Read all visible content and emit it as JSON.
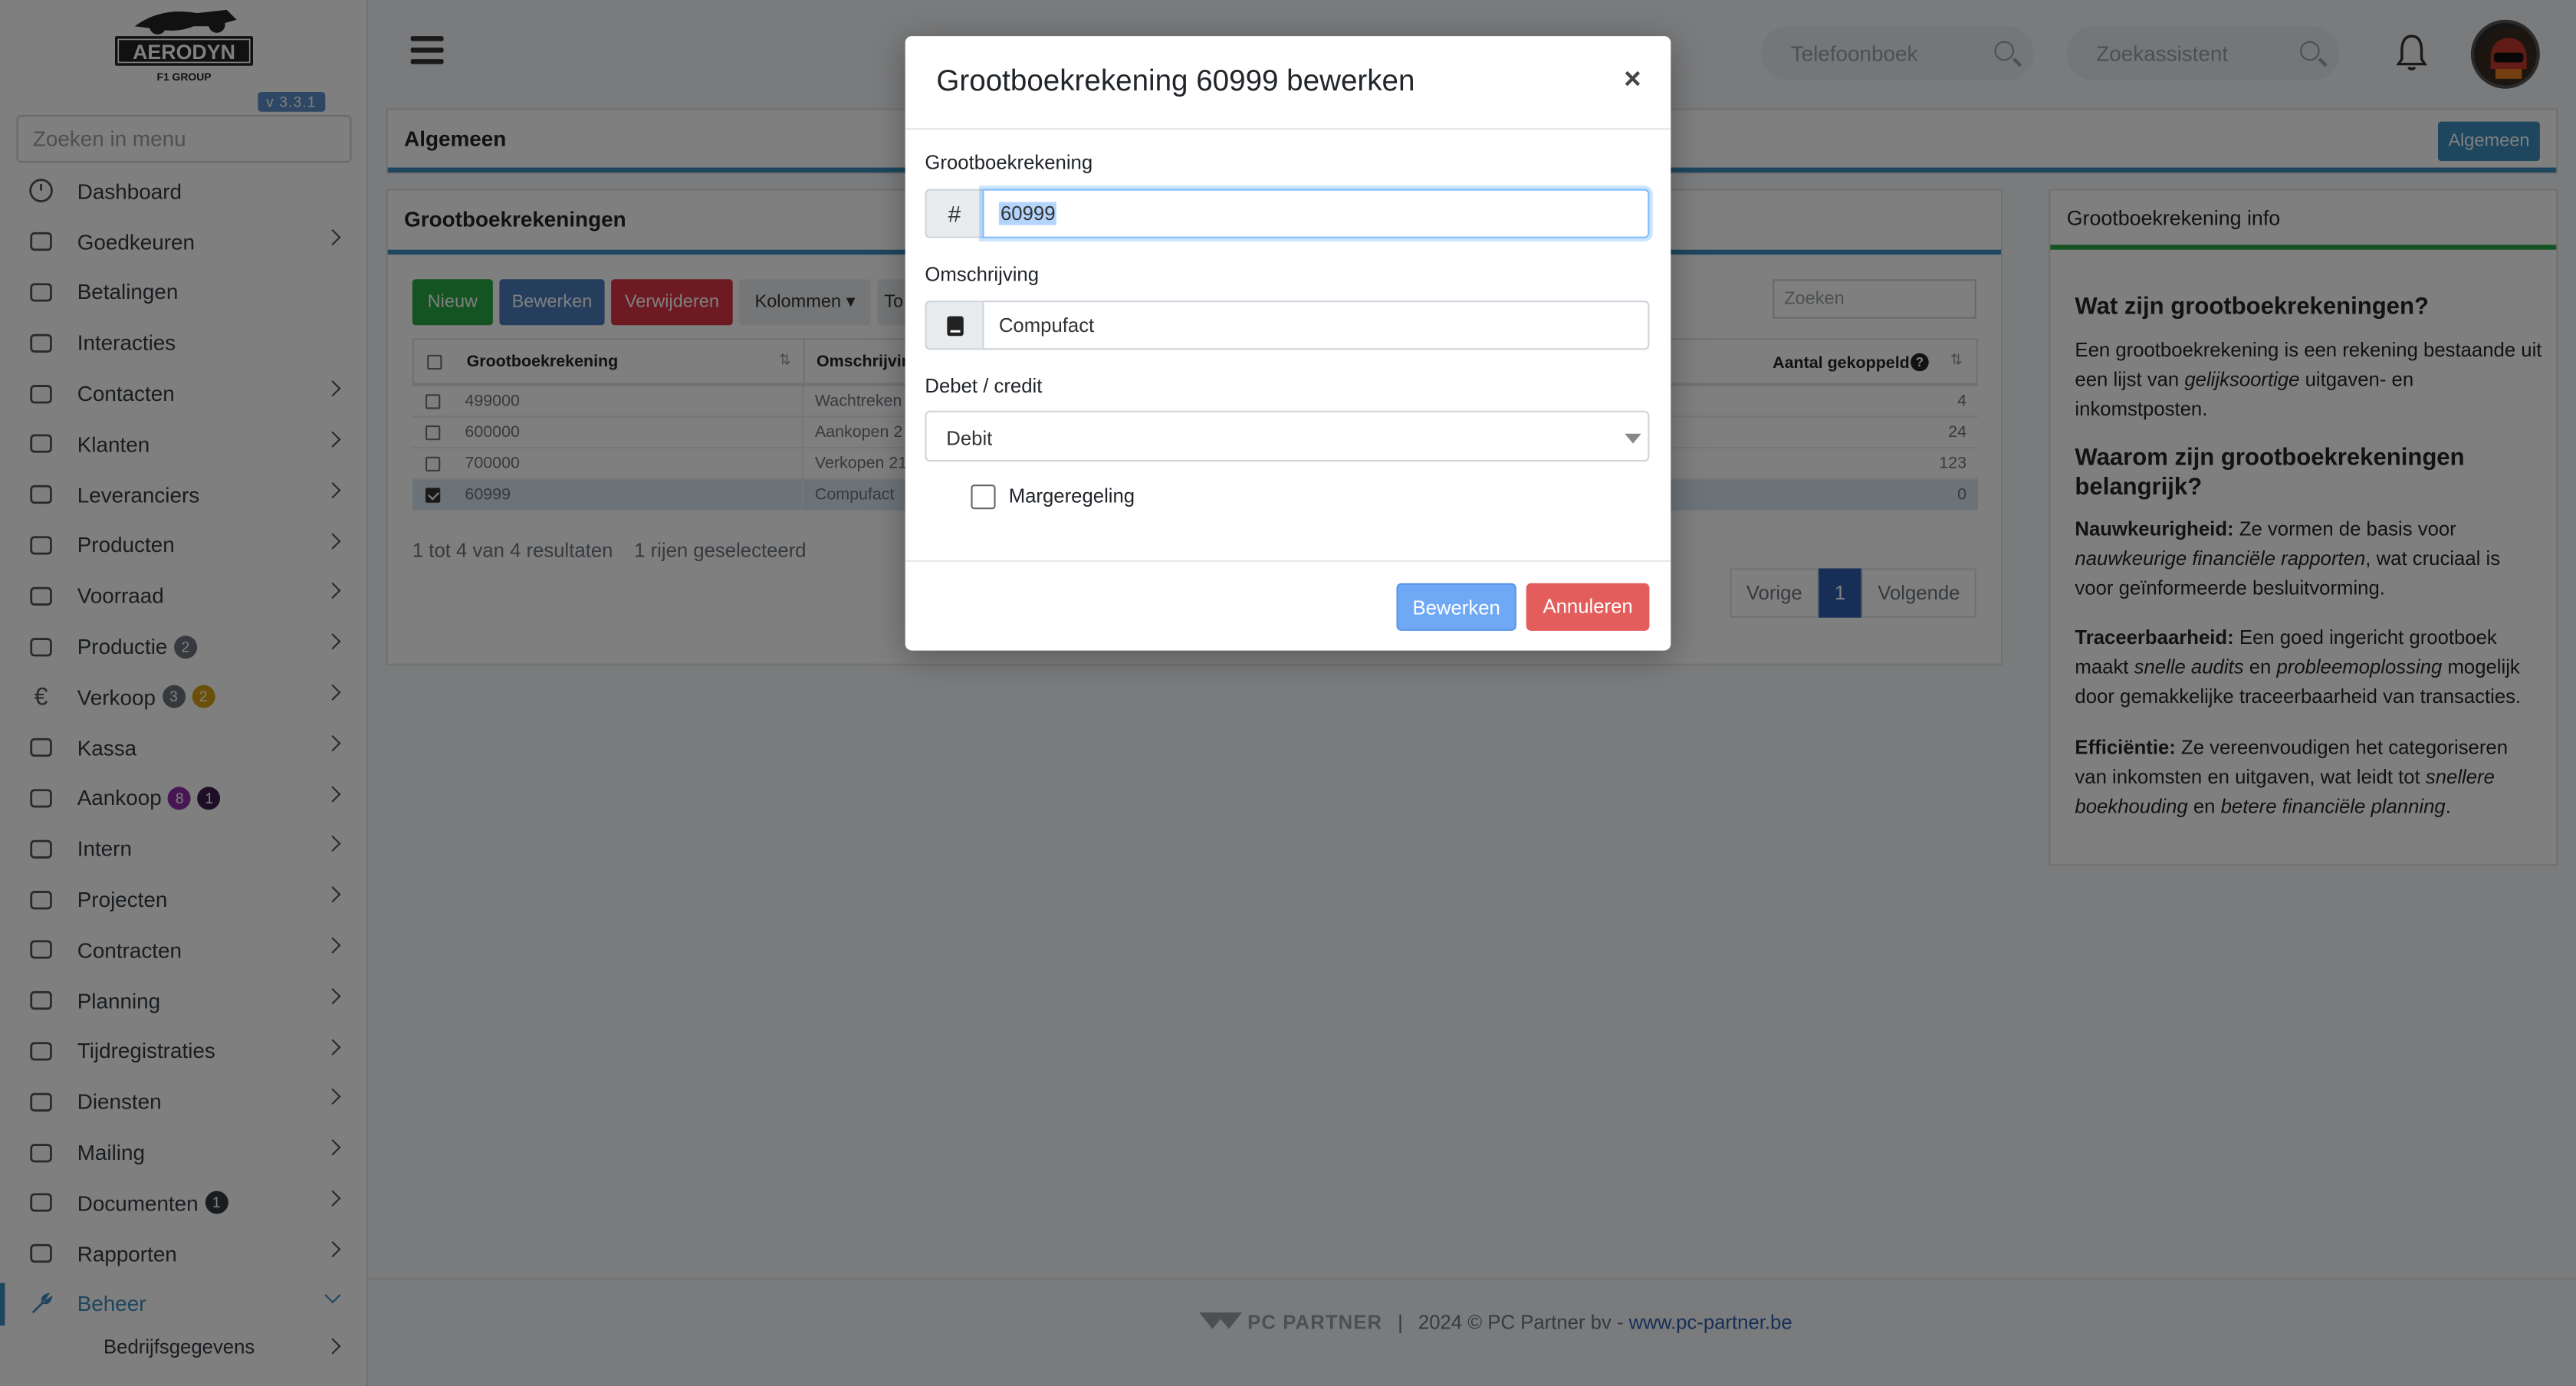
{
  "app": {
    "logo_text": "AERODYN",
    "logo_sub": "F1 GROUP",
    "version": "v 3.3.1"
  },
  "sidebar": {
    "search_placeholder": "Zoeken in menu",
    "items": [
      {
        "label": "Dashboard",
        "icon": "dashboard-icon",
        "chevron": false
      },
      {
        "label": "Goedkeuren",
        "icon": "user-check-icon",
        "chevron": true
      },
      {
        "label": "Betalingen",
        "icon": "credit-card-icon",
        "chevron": false
      },
      {
        "label": "Interacties",
        "icon": "chat-icon",
        "chevron": false
      },
      {
        "label": "Contacten",
        "icon": "contact-card-icon",
        "chevron": true
      },
      {
        "label": "Klanten",
        "icon": "person-icon",
        "chevron": true
      },
      {
        "label": "Leveranciers",
        "icon": "truck-icon",
        "chevron": true
      },
      {
        "label": "Producten",
        "icon": "box-icon",
        "chevron": true
      },
      {
        "label": "Voorraad",
        "icon": "stack-icon",
        "chevron": true
      },
      {
        "label": "Productie",
        "icon": "gears-icon",
        "chevron": true,
        "badges": [
          {
            "value": "2",
            "color": "gray"
          }
        ]
      },
      {
        "label": "Verkoop",
        "icon": "euro-icon",
        "chevron": true,
        "badges": [
          {
            "value": "3",
            "color": "gray"
          },
          {
            "value": "2",
            "color": "yellow"
          }
        ]
      },
      {
        "label": "Kassa",
        "icon": "basket-icon",
        "chevron": true
      },
      {
        "label": "Aankoop",
        "icon": "cart-icon",
        "chevron": true,
        "badges": [
          {
            "value": "8",
            "color": "purple"
          },
          {
            "value": "1",
            "color": "darkpurple"
          }
        ]
      },
      {
        "label": "Intern",
        "icon": "users-icon",
        "chevron": true
      },
      {
        "label": "Projecten",
        "icon": "project-icon",
        "chevron": true
      },
      {
        "label": "Contracten",
        "icon": "contract-icon",
        "chevron": true
      },
      {
        "label": "Planning",
        "icon": "calendar-icon",
        "chevron": true
      },
      {
        "label": "Tijdregistraties",
        "icon": "timer-icon",
        "chevron": true
      },
      {
        "label": "Diensten",
        "icon": "refresh-icon",
        "chevron": true
      },
      {
        "label": "Mailing",
        "icon": "paper-plane-icon",
        "chevron": true
      },
      {
        "label": "Documenten",
        "icon": "folder-icon",
        "chevron": true,
        "badges": [
          {
            "value": "1",
            "color": "dark"
          }
        ]
      },
      {
        "label": "Rapporten",
        "icon": "chart-line-icon",
        "chevron": true
      },
      {
        "label": "Beheer",
        "icon": "wrench-icon",
        "chevron": true,
        "active": true
      }
    ],
    "sub_items": [
      {
        "label": "Bedrijfsgegevens"
      }
    ]
  },
  "topbar": {
    "phonebook_placeholder": "Telefoonboek",
    "assistant_placeholder": "Zoekassistent"
  },
  "page": {
    "section_title": "Algemeen",
    "section_button": "Algemeen",
    "list_title": "Grootboekrekeningen",
    "toolbar": {
      "new": "Nieuw",
      "edit": "Bewerken",
      "delete": "Verwijderen",
      "columns": "Kolommen",
      "partial_button": "To",
      "search_placeholder": "Zoeken"
    },
    "table": {
      "headers": {
        "account": "Grootboekrekening",
        "description": "Omschrijvin",
        "linked": "Aantal gekoppeld"
      },
      "rows": [
        {
          "account": "499000",
          "description": "Wachtreken",
          "linked": "4",
          "selected": false
        },
        {
          "account": "600000",
          "description": "Aankopen 2",
          "linked": "24",
          "selected": false
        },
        {
          "account": "700000",
          "description": "Verkopen 21",
          "linked": "123",
          "selected": false
        },
        {
          "account": "60999",
          "description": "Compufact",
          "linked": "0",
          "selected": true
        }
      ]
    },
    "results_text": "1 tot 4 van 4 resultaten",
    "selected_text": "1 rijen geselecteerd",
    "pagination": {
      "prev": "Vorige",
      "current": "1",
      "next": "Volgende"
    }
  },
  "info": {
    "title": "Grootboekrekening info",
    "h1": "Wat zijn grootboekrekeningen?",
    "p1_a": "Een grootboekrekening is een rekening bestaande uit een lijst van ",
    "p1_em": "gelijksoortige",
    "p1_b": " uitgaven- en inkomstposten.",
    "h2": "Waarom zijn grootboekrekeningen belangrijk?",
    "p2_strong": "Nauwkeurigheid:",
    "p2_a": " Ze vormen de basis voor ",
    "p2_em": "nauwkeurige financiële rapporten",
    "p2_b": ", wat cruciaal is voor geïnformeerde besluitvorming.",
    "p3_strong": "Traceerbaarheid:",
    "p3_a": " Een goed ingericht grootboek maakt ",
    "p3_em1": "snelle audits",
    "p3_b": " en ",
    "p3_em2": "probleemoplossing",
    "p3_c": " mogelijk door gemakkelijke traceerbaarheid van transacties.",
    "p4_strong": "Efficiëntie:",
    "p4_a": " Ze vereenvoudigen het categoriseren van inkomsten en uitgaven, wat leidt tot ",
    "p4_em1": "snellere boekhouding",
    "p4_b": " en ",
    "p4_em2": "betere financiële planning",
    "p4_c": "."
  },
  "modal": {
    "title": "Grootboekrekening 60999 bewerken",
    "close": "×",
    "account_label": "Grootboekrekening",
    "account_addon": "#",
    "account_value": "60999",
    "description_label": "Omschrijving",
    "description_value": "Compufact",
    "debit_credit_label": "Debet / credit",
    "debit_credit_value": "Debit",
    "margin_label": "Margeregeling",
    "margin_checked": false,
    "submit": "Bewerken",
    "cancel": "Annuleren"
  },
  "footer": {
    "brand": "PC PARTNER",
    "sep": "|",
    "text": "2024 © PC Partner bv - ",
    "link": "www.pc-partner.be"
  },
  "colors": {
    "accent": "#3c8dbc",
    "green": "#28a745",
    "blue": "#4a7dbd",
    "red": "#dc3545",
    "modal_primary": "#6fa8f5",
    "modal_danger": "#e35d5d"
  }
}
